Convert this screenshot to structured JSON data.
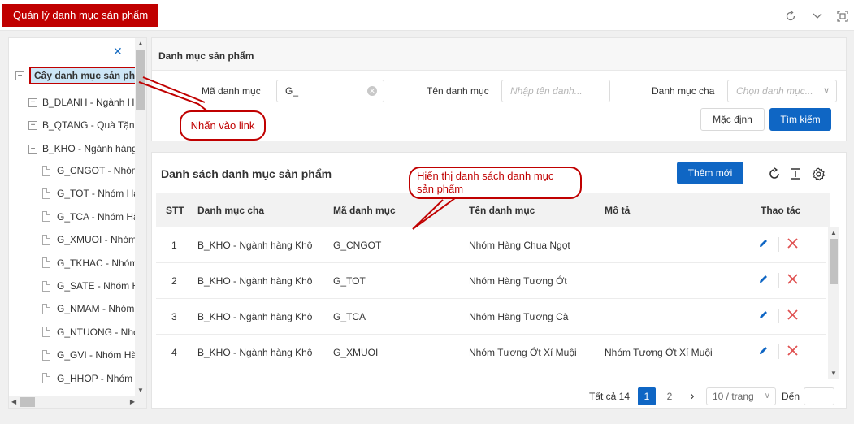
{
  "tab": {
    "title": "Quản lý danh mục sản phẩm"
  },
  "tree": {
    "root": "Cây danh mục sản phẩm",
    "level1": [
      {
        "label": "B_DLANH - Ngành H",
        "expander": "+"
      },
      {
        "label": "B_QTANG - Quà Tặng",
        "expander": "+"
      },
      {
        "label": "B_KHO - Ngành hàng",
        "expander": "−"
      }
    ],
    "level2": [
      "G_CNGOT - Nhóm",
      "G_TOT - Nhóm Hà",
      "G_TCA - Nhóm Hà",
      "G_XMUOI - Nhóm",
      "G_TKHAC - Nhóm",
      "G_SATE - Nhóm H",
      "G_NMAM - Nhóm",
      "G_NTUONG - Nhó",
      "G_GVI - Nhóm Hà",
      "G_HHOP - Nhóm"
    ]
  },
  "search": {
    "header": "Danh mục sản phẩm",
    "code_label": "Mã danh mục",
    "code_value": "G_",
    "name_label": "Tên danh mục",
    "name_placeholder": "Nhập tên danh...",
    "parent_label": "Danh mục cha",
    "parent_placeholder": "Chọn danh mục...",
    "reset_button": "Mặc định",
    "search_button": "Tìm kiếm"
  },
  "list": {
    "title": "Danh sách danh mục sản phẩm",
    "add_button": "Thêm mới",
    "columns": [
      "STT",
      "Danh mục cha",
      "Mã danh mục",
      "Tên danh mục",
      "Mô tả",
      "Thao tác"
    ],
    "rows": [
      {
        "stt": "1",
        "parent": "B_KHO - Ngành hàng Khô",
        "code": "G_CNGOT",
        "name": "Nhóm Hàng Chua Ngọt",
        "desc": ""
      },
      {
        "stt": "2",
        "parent": "B_KHO - Ngành hàng Khô",
        "code": "G_TOT",
        "name": "Nhóm Hàng Tương Ớt",
        "desc": ""
      },
      {
        "stt": "3",
        "parent": "B_KHO - Ngành hàng Khô",
        "code": "G_TCA",
        "name": "Nhóm Hàng Tương Cà",
        "desc": ""
      },
      {
        "stt": "4",
        "parent": "B_KHO - Ngành hàng Khô",
        "code": "G_XMUOI",
        "name": "Nhóm Tương Ớt Xí Muội",
        "desc": "Nhóm Tương Ớt Xí Muội"
      }
    ]
  },
  "pagination": {
    "total": "Tất cả 14",
    "page1": "1",
    "page2": "2",
    "next": "›",
    "per_page": "10 / trang",
    "goto_label": "Đến"
  },
  "callouts": {
    "link": "Nhấn vào link",
    "list_line1": "Hiển thị danh sách danh mục",
    "list_line2": "sản phẩm"
  },
  "colors": {
    "brand_red": "#c00000",
    "primary_blue": "#0f66c4",
    "delete_red": "#e05252"
  }
}
